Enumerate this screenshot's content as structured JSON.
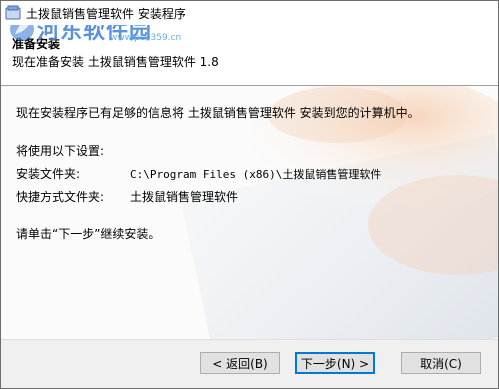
{
  "window": {
    "title": "土拨鼠销售管理软件 安装程序"
  },
  "watermark": {
    "text": "河东软件园",
    "url": "www.pc0359.cn"
  },
  "header": {
    "title": "准备安装",
    "subtitle": "现在准备安装 土拨鼠销售管理软件 1.8"
  },
  "body": {
    "intro": "现在安装程序已有足够的信息将 土拨鼠销售管理软件 安装到您的计算机中。",
    "settings_heading": "将使用以下设置:",
    "install_folder_label": "安装文件夹:",
    "install_folder_value": "C:\\Program Files (x86)\\土拨鼠销售管理软件",
    "shortcut_folder_label": "快捷方式文件夹:",
    "shortcut_folder_value": "土拨鼠销售管理软件",
    "instruction": "请单击“下一步”继续安装。"
  },
  "buttons": {
    "back": "< 返回(B)",
    "next": "下一步(N) >",
    "cancel": "取消(C)"
  }
}
